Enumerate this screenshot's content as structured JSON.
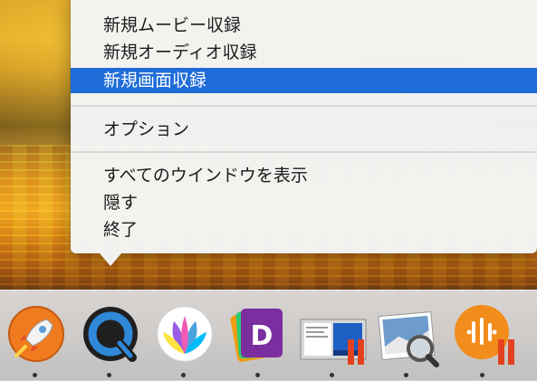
{
  "context_menu": {
    "items": [
      {
        "label": "新規ムービー収録"
      },
      {
        "label": "新規オーディオ収録"
      },
      {
        "label": "新規画面収録"
      },
      {
        "label": "オプション"
      },
      {
        "label": "すべてのウインドウを表示"
      },
      {
        "label": "隠す"
      },
      {
        "label": "終了"
      }
    ],
    "highlighted": "新規画面収録",
    "highlight_color": "#1f6cd8"
  },
  "dock": {
    "apps": [
      {
        "icon": "rocket-icon"
      },
      {
        "icon": "quicktime-icon"
      },
      {
        "icon": "petals-icon"
      },
      {
        "icon": "dash-icon"
      },
      {
        "icon": "screenshot-window-icon",
        "badge_icon": "pause-badge-icon"
      },
      {
        "icon": "preview-icon"
      },
      {
        "icon": "podcast-icon",
        "badge_icon": "pause-badge-icon"
      }
    ]
  }
}
